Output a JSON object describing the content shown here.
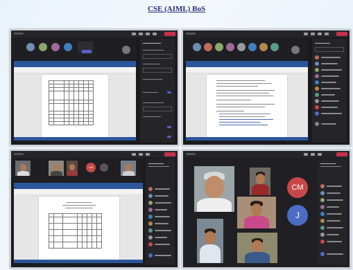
{
  "page": {
    "title": "CSE (AIML) BoS"
  },
  "screenshots": [
    {
      "name": "top-left",
      "participant_initials": [
        "",
        "",
        "",
        "",
        "",
        ""
      ],
      "shared_content": "spreadsheet-like document with table",
      "side_panel": "settings"
    },
    {
      "name": "top-right",
      "participant_initials": [
        "",
        "",
        "",
        "",
        "",
        "",
        "",
        ""
      ],
      "shared_content": "word document with text",
      "side_panel": "participants"
    },
    {
      "name": "bottom-left",
      "participant_initials": [
        "",
        "",
        "",
        "CM",
        "",
        ""
      ],
      "shared_content": "word document with table",
      "side_panel": "participants"
    },
    {
      "name": "bottom-right",
      "participant_initials": [
        "CM",
        "J"
      ],
      "shared_content": "video gallery",
      "side_panel": "participants"
    }
  ],
  "colors": {
    "teams_dark": "#1b1b1f",
    "leave_red": "#c4314b",
    "word_blue": "#2b579a",
    "accent_purple": "#5b5fc7",
    "cm_avatar": "#c8484a",
    "j_avatar": "#4b6cc4"
  },
  "labels": {
    "cm": "CM",
    "j": "J"
  }
}
